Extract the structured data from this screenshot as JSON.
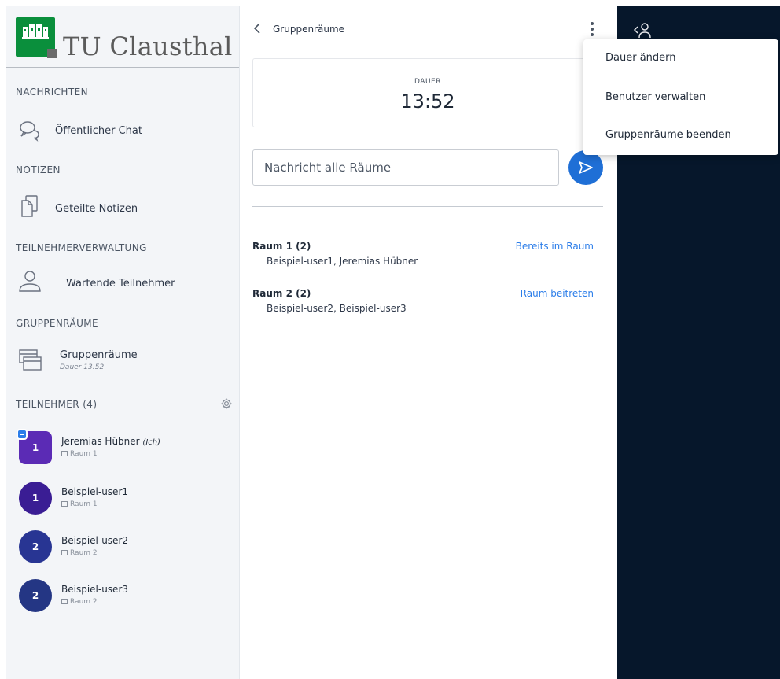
{
  "brand": {
    "name": "TU Clausthal"
  },
  "sidebar": {
    "sections": [
      {
        "heading": "NACHRICHTEN",
        "item": {
          "label": "Öffentlicher Chat",
          "icon": "chat-icon"
        }
      },
      {
        "heading": "NOTIZEN",
        "item": {
          "label": "Geteilte Notizen",
          "icon": "notes-icon"
        }
      },
      {
        "heading": "TEILNEHMERVERWALTUNG",
        "item": {
          "label": "Wartende Teilnehmer",
          "icon": "user-icon"
        }
      },
      {
        "heading": "GRUPPENRÄUME",
        "item": {
          "label": "Gruppenräume",
          "sub": "Dauer 13:52",
          "icon": "breakout-icon"
        }
      }
    ],
    "participants": {
      "heading": "TEILNEHMER (4)",
      "users": [
        {
          "name": "Jeremias Hübner",
          "self_tag": "(Ich)",
          "initial": "1",
          "room": "Raum 1",
          "color": "#5b2bb5",
          "moderator": true
        },
        {
          "name": "Beispiel-user1",
          "initial": "1",
          "room": "Raum 1",
          "color": "#3a1d94",
          "moderator": false
        },
        {
          "name": "Beispiel-user2",
          "initial": "2",
          "room": "Raum 2",
          "color": "#283593",
          "moderator": false
        },
        {
          "name": "Beispiel-user3",
          "initial": "2",
          "room": "Raum 2",
          "color": "#243684",
          "moderator": false
        }
      ]
    }
  },
  "main": {
    "title": "Gruppenräume",
    "timer": {
      "label": "DAUER",
      "value": "13:52"
    },
    "message_placeholder": "Nachricht alle Räume",
    "rooms": [
      {
        "name": "Raum 1 (2)",
        "users": "Beispiel-user1, Jeremias Hübner",
        "action": "Bereits im Raum"
      },
      {
        "name": "Raum 2 (2)",
        "users": "Beispiel-user2, Beispiel-user3",
        "action": "Raum beitreten"
      }
    ]
  },
  "menu": {
    "items": [
      "Dauer ändern",
      "Benutzer verwalten",
      "Gruppenräume beenden"
    ]
  },
  "colors": {
    "accent": "#2b7de9",
    "send_button": "#1f6fd6",
    "dark_panel": "#06172b",
    "logo_green": "#0a8f3c"
  }
}
